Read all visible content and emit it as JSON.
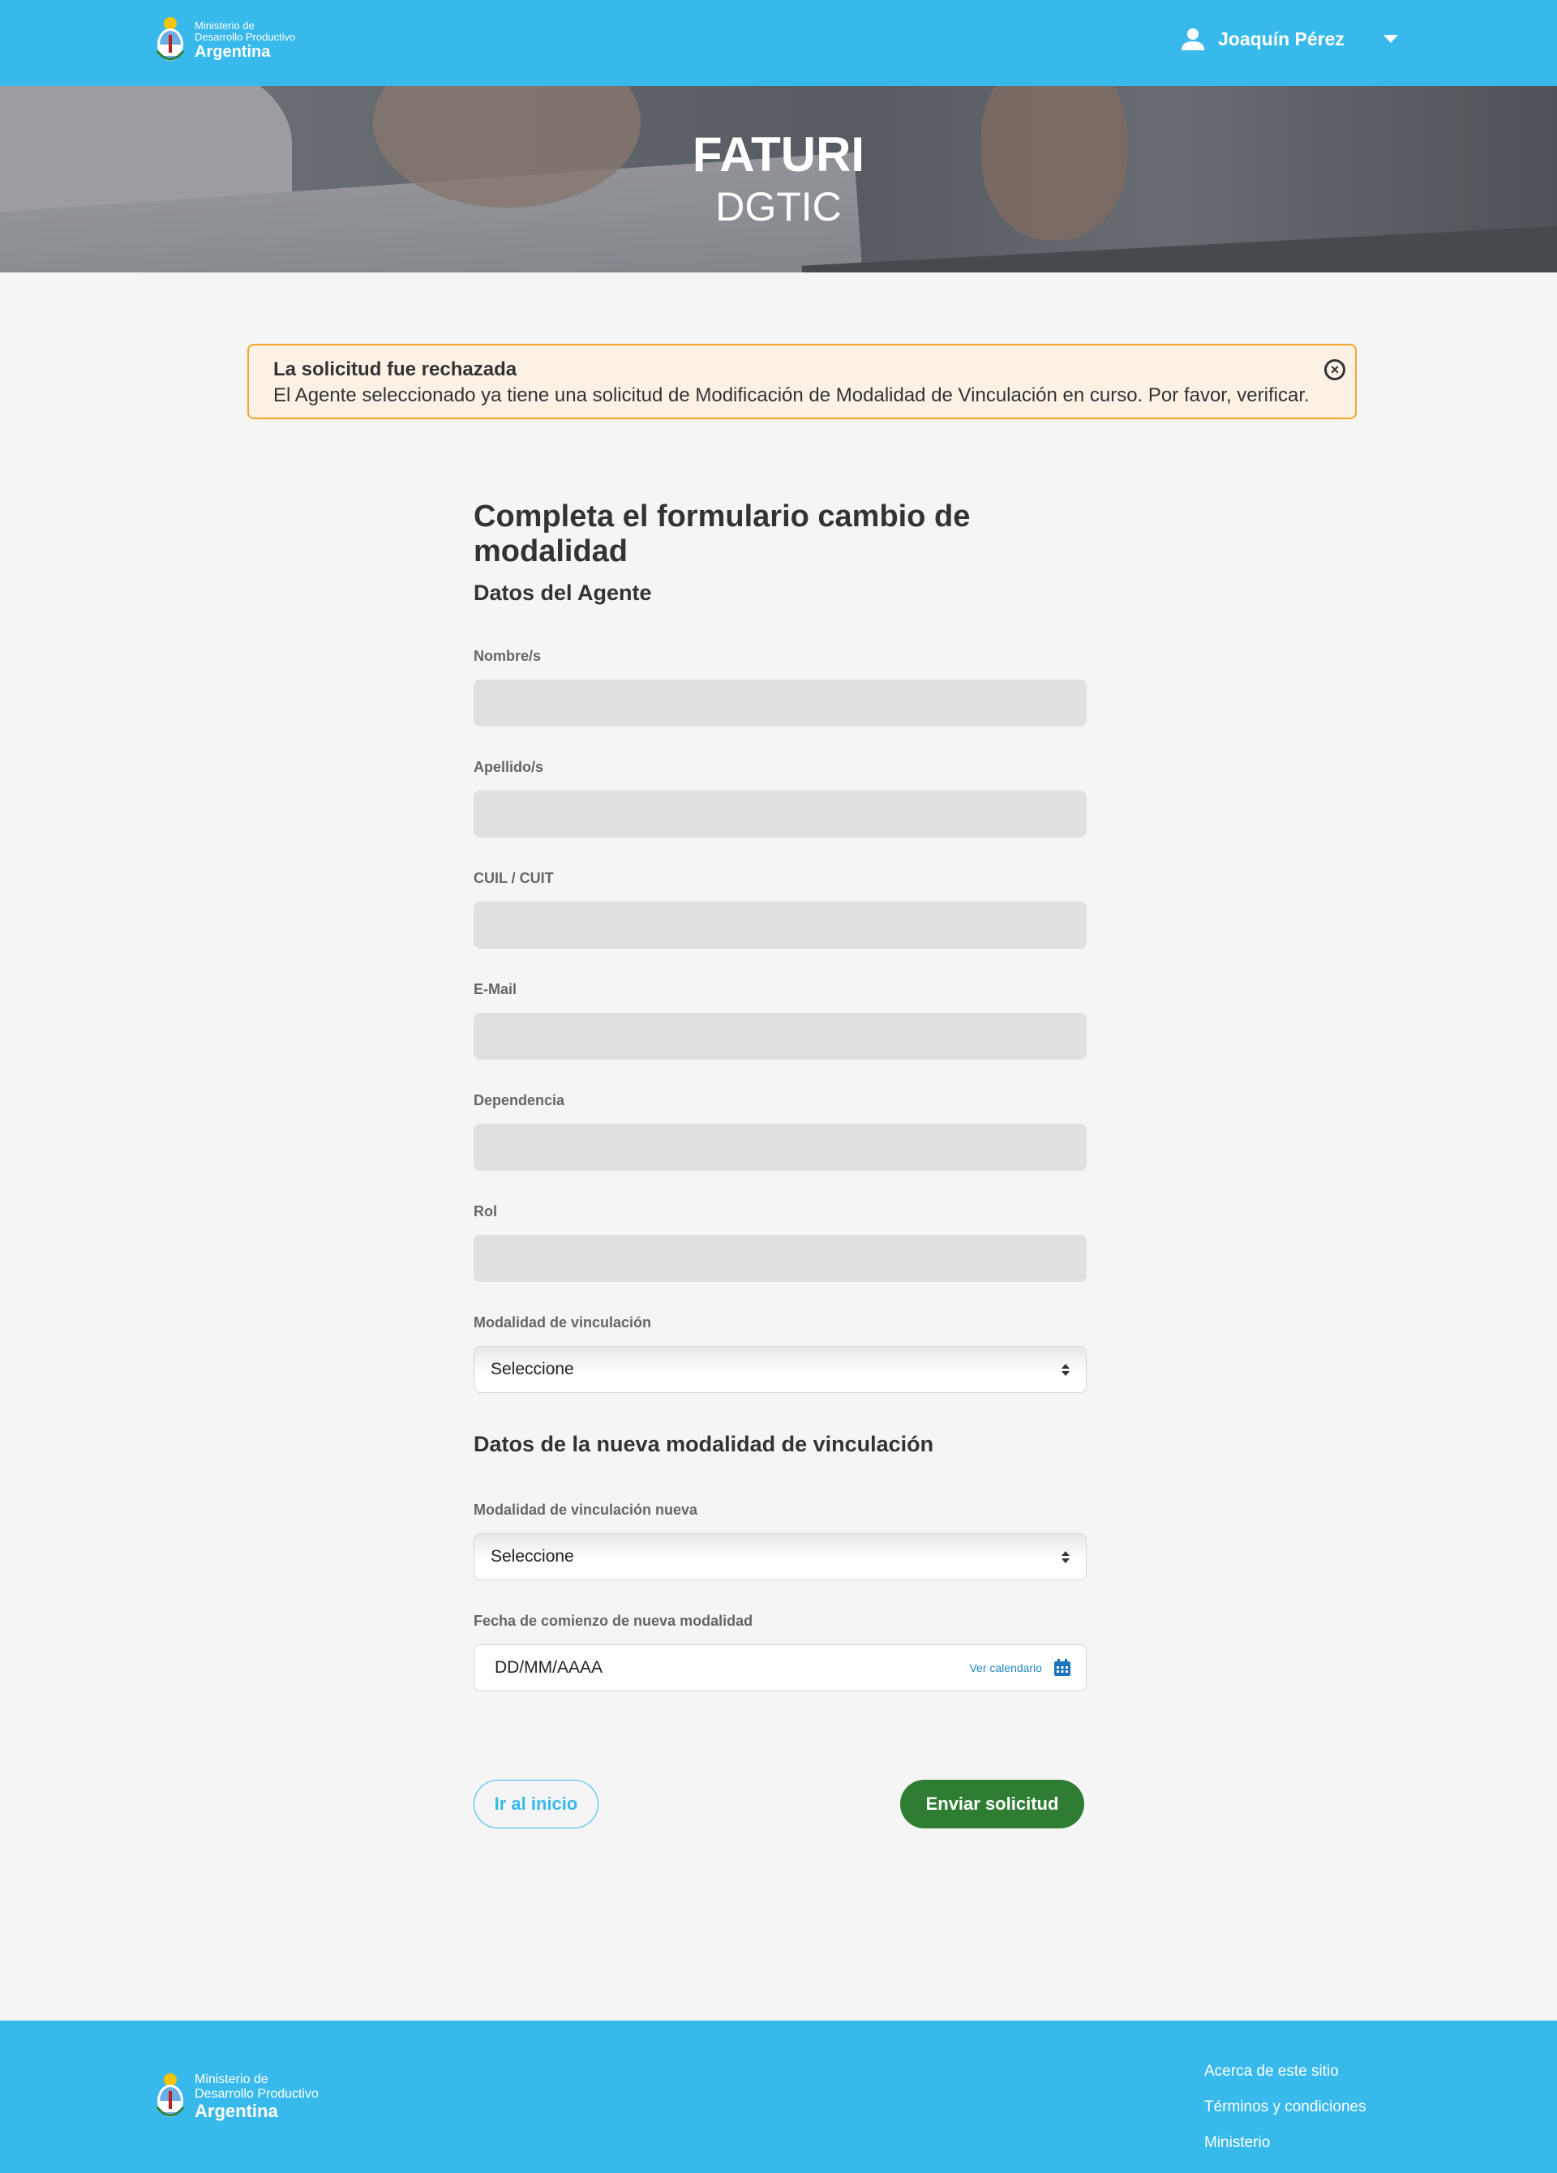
{
  "header": {
    "logo": {
      "line1": "Ministerio de",
      "line2": "Desarrollo Productivo",
      "line3": "Argentina"
    },
    "user_name": "Joaquín Pérez"
  },
  "hero": {
    "title": "FATURI",
    "subtitle": "DGTIC"
  },
  "alert": {
    "title": "La solicitud fue rechazada",
    "message": "El Agente seleccionado ya tiene una solicitud de Modificación de Modalidad de Vinculación en curso. Por favor, verificar.",
    "border_color": "#f5a623"
  },
  "form": {
    "title": "Completa el formulario cambio de modalidad",
    "section1": "Datos del Agente",
    "fields": {
      "nombre": {
        "label": "Nombre/s",
        "value": ""
      },
      "apellido": {
        "label": "Apellido/s",
        "value": ""
      },
      "cuil": {
        "label": "CUIL / CUIT",
        "value": ""
      },
      "email": {
        "label": "E-Mail",
        "value": ""
      },
      "dependencia": {
        "label": "Dependencia",
        "value": ""
      },
      "rol": {
        "label": "Rol",
        "value": ""
      },
      "modalidad": {
        "label": "Modalidad de vinculación",
        "selected": "Seleccione"
      }
    },
    "section2": "Datos de la nueva modalidad de vinculación",
    "fields2": {
      "modalidad_nueva": {
        "label": "Modalidad de vinculación nueva",
        "selected": "Seleccione"
      },
      "fecha": {
        "label": "Fecha de comienzo de nueva modalidad",
        "placeholder": "DD/MM/AAAA",
        "calendar_link": "Ver calendario"
      }
    },
    "buttons": {
      "home": "Ir al inicio",
      "submit": "Enviar solicitud"
    }
  },
  "footer": {
    "logo": {
      "line1": "Ministerio de",
      "line2": "Desarrollo Productivo",
      "line3": "Argentina"
    },
    "links": [
      "Acerca de este sitio",
      "Términos y condiciones",
      "Ministerio"
    ]
  },
  "colors": {
    "brand_blue": "#38b9eb",
    "submit_green": "#2e7d32",
    "input_bg": "#e0e0e0"
  }
}
